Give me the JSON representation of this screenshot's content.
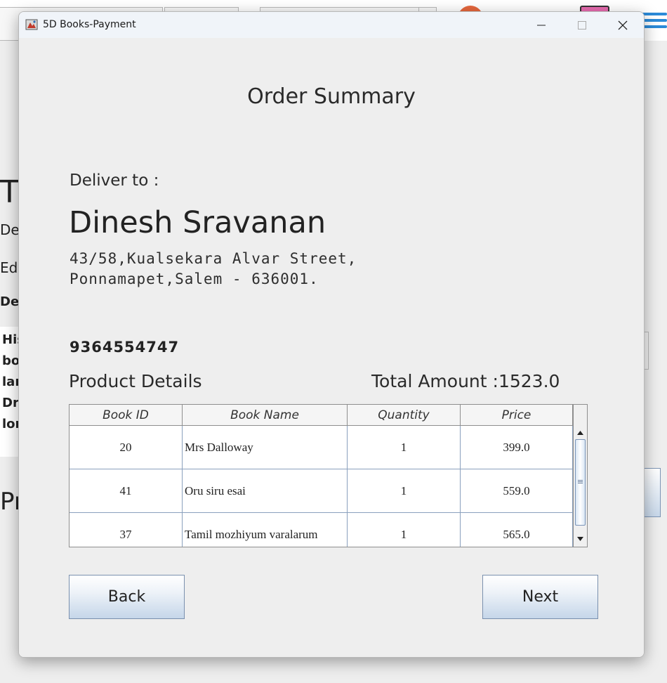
{
  "window": {
    "title": "5D Books-Payment"
  },
  "background": {
    "letters": [
      "T",
      "De",
      "Ed",
      "De",
      "His",
      "bo",
      "lar",
      "Dr",
      "lor",
      "Pr"
    ]
  },
  "order": {
    "heading": "Order Summary",
    "deliver_label": "Deliver to :",
    "customer_name": "Dinesh Sravanan",
    "address_line1": "43/58,Kualsekara Alvar Street,",
    "address_line2": "Ponnamapet,Salem - 636001.",
    "phone": "9364554747",
    "product_details_label": "Product Details",
    "total_amount": "Total Amount :1523.0"
  },
  "table": {
    "columns": [
      "Book ID",
      "Book Name",
      "Quantity",
      "Price"
    ],
    "rows": [
      {
        "id": "20",
        "name": "Mrs Dalloway",
        "qty": "1",
        "price": "399.0"
      },
      {
        "id": "41",
        "name": "Oru siru esai",
        "qty": "1",
        "price": "559.0"
      },
      {
        "id": "37",
        "name": "Tamil mozhiyum varalarum",
        "qty": "1",
        "price": "565.0"
      }
    ]
  },
  "buttons": {
    "back": "Back",
    "next": "Next"
  },
  "icons": {
    "app": "java-app-icon",
    "minimize": "minimize-icon",
    "maximize": "maximize-icon",
    "close": "close-icon",
    "scroll_up": "scroll-up-icon",
    "scroll_down": "scroll-down-icon"
  },
  "colors": {
    "dialog_bg": "#eeeeee",
    "button_border": "#7a90ae",
    "button_gradient_bottom": "#c5d6e9",
    "titlebar_bg": "#f0f4f9"
  }
}
